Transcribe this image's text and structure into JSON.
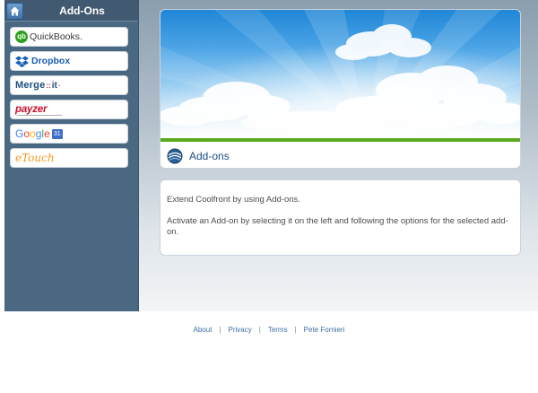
{
  "sidebar": {
    "title": "Add-Ons",
    "home_icon": "home-icon",
    "items": [
      {
        "name": "QuickBooks",
        "mark": "qb",
        "label": "QuickBooks."
      },
      {
        "name": "Dropbox",
        "label": "Dropbox"
      },
      {
        "name": "Merge it",
        "label_left": "Merge",
        "label_dots": "::",
        "label_right": "it",
        "suffix": "·"
      },
      {
        "name": "payzer",
        "label": "payzer"
      },
      {
        "name": "Google",
        "label": "Google",
        "badge": "31"
      },
      {
        "name": "eTouch",
        "label": "eTouch"
      }
    ]
  },
  "hero": {
    "title": "Add-ons",
    "icon": "globe-icon",
    "accent_color": "#5aaa1e"
  },
  "info": {
    "line1": "Extend Coolfront by using Add-ons.",
    "line2": "Activate an Add-on by selecting it on the left and following the options for the selected add-on."
  },
  "footer": {
    "links": [
      "About",
      "Privacy",
      "Terms",
      "Pete Fornieri"
    ],
    "separator": "|"
  },
  "colors": {
    "sidebar_bg": "#4b6882",
    "title_blue": "#1c4e87",
    "link_blue": "#3c6ea5"
  }
}
